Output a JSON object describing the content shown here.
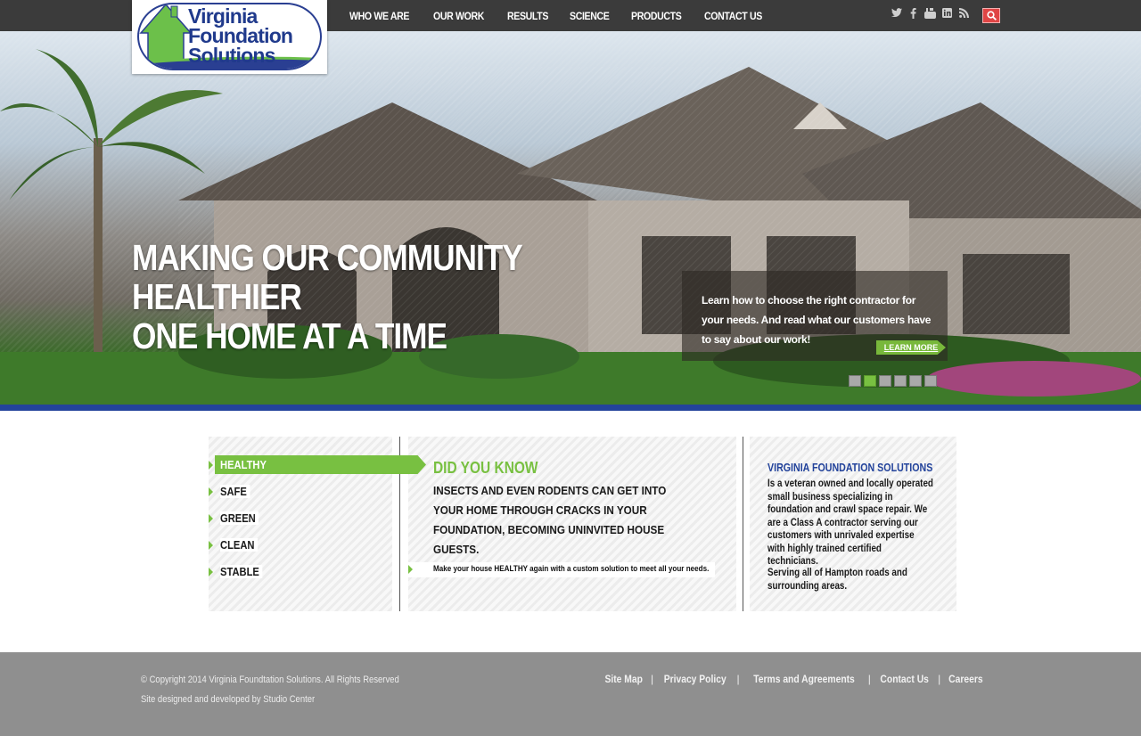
{
  "brand": {
    "logo_line1": "Virginia",
    "logo_line2": "Foundation",
    "logo_line3": "Solutions"
  },
  "nav": {
    "items": [
      "WHO WE ARE",
      "OUR WORK",
      "RESULTS",
      "SCIENCE",
      "PRODUCTS",
      "CONTACT US"
    ]
  },
  "social": {
    "icons": [
      "twitter-icon",
      "facebook-icon",
      "youtube-icon",
      "linkedin-icon",
      "rss-icon"
    ]
  },
  "hero": {
    "line1": "MAKING OUR COMMUNITY",
    "line2": "HEALTHIER",
    "line3": "ONE HOME AT A TIME",
    "promo_text": "Learn how to choose the right contractor for your needs. And read what our customers have to say about our work!",
    "learn_more": "LEARN MORE",
    "slides": 6,
    "active_slide": 2
  },
  "tabs": {
    "items": [
      "HEALTHY",
      "SAFE",
      "GREEN",
      "CLEAN",
      "STABLE"
    ],
    "active": "HEALTHY"
  },
  "did_you_know": {
    "title": "DID YOU KNOW",
    "body": "INSECTS AND EVEN RODENTS CAN GET INTO YOUR HOME THROUGH CRACKS IN YOUR FOUNDATION, BECOMING UNINVITED HOUSE GUESTS.",
    "cta": "Make your house HEALTHY again with a custom solution to meet all your needs."
  },
  "about": {
    "title": "VIRGINIA FOUNDATION SOLUTIONS",
    "body": "Is a veteran owned and locally operated small business specializing in foundation and crawl space repair. We are a Class A contractor serving our customers with unrivaled expertise with highly trained certified technicians.",
    "areas": "Serving all of Hampton roads and surrounding areas."
  },
  "footer": {
    "copyright": "© Copyright 2014 Virginia Foundtation Solutions. All Rights Reserved",
    "credit": "Site designed and developed by Studio Center",
    "links": [
      "Site Map",
      "Privacy Policy",
      "Terms and Agreements",
      "Contact Us",
      "Careers"
    ]
  },
  "colors": {
    "accent_green": "#78c041",
    "brand_blue": "#23439b",
    "nav_bg": "#3b3b3b",
    "footer_bg": "#8f8f8f"
  }
}
